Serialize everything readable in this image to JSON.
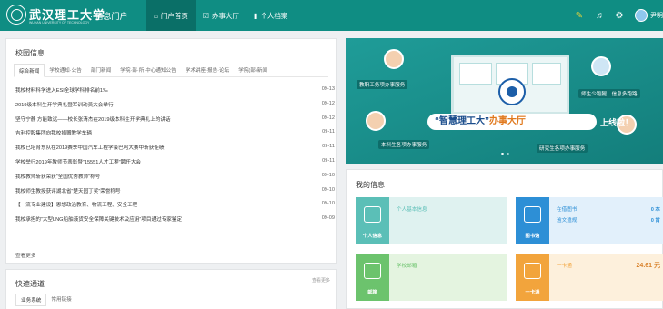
{
  "header": {
    "logo_text": "武汉理工大学",
    "logo_sub": "WUHAN UNIVERSITY OF TECHNOLOGY",
    "portal_title": "· 信息门户",
    "nav": [
      {
        "label": "门户首页",
        "icon": "home-icon",
        "active": true
      },
      {
        "label": "办事大厅",
        "icon": "service-hall-icon",
        "active": false
      },
      {
        "label": "个人档案",
        "icon": "bar-chart-icon",
        "active": false
      }
    ],
    "username": "尹明"
  },
  "news": {
    "title": "校园信息",
    "tabs": [
      "综合新闻",
      "学校通知·公告",
      "部门新闻",
      "学院·部·所·中心通知公告",
      "学术讲座·报告·论坛",
      "学院(部)新闻"
    ],
    "items": [
      {
        "title": "我校材料科学进入ESI全球学科排名前1‰",
        "date": "09-13"
      },
      {
        "title": "2019级本科生开学典礼暨军训动员大会举行",
        "date": "09-12"
      },
      {
        "title": "坚守宁静 方能致远——校长张清杰在2019级本科生开学典礼上的讲话",
        "date": "09-12"
      },
      {
        "title": "吉利控股集团向我校捐赠教学车辆",
        "date": "09-11"
      },
      {
        "title": "我校已培育东队在2019赛季中国汽车工程学会巴哈大赛中斩获佳绩",
        "date": "09-11"
      },
      {
        "title": "学校举行2019年教师节表彰暨“15551人才工程”聘任大会",
        "date": "09-11"
      },
      {
        "title": "我校教师斩获荣获“全国优秀教师”称号",
        "date": "09-10"
      },
      {
        "title": "我校师生教授获评湖北省“楚天园丁奖”荣誉称号",
        "date": "09-10"
      },
      {
        "title": "【一流专业建设】恩想政治教育、物流工程、安全工程",
        "date": "09-10"
      },
      {
        "title": "我校承担的“大型LNG船舶液货安全保障关键技术及应用”项目通过专家鉴定",
        "date": "09-09"
      }
    ],
    "more": "查看更多"
  },
  "quick": {
    "title": "快速通道",
    "more": "查看更多",
    "tabs": [
      "业务系统",
      "常用链接"
    ]
  },
  "banner": {
    "slogan_quote_open": "“智慧理工大”",
    "slogan_hl": "办事大厅",
    "slogan_quote_close": "”",
    "slogan_after": "上线啦！",
    "labels": {
      "teacher": "教职工务项办事服务",
      "student": "师生少跑腿、信息多跑路",
      "undergrad": "本科生各项办事服务",
      "grad": "研究生各项办事服务"
    }
  },
  "my_info": {
    "title": "我的信息",
    "tiles": [
      {
        "name": "个人信息",
        "text1": "个人基本信息",
        "text2": "",
        "value1": "",
        "value2": "",
        "color": "#5bbfb7",
        "bg": "#dff2f0"
      },
      {
        "name": "图书馆",
        "text1": "在借图书",
        "text2": "逾文違规",
        "value1": "0 本",
        "value2": "0 肯",
        "color": "#2d8fd6",
        "bg": "#e2f0fb"
      },
      {
        "name": "邮箱",
        "text1": "学校邮箱",
        "text2": "",
        "value1": "",
        "value2": "",
        "color": "#6cc36d",
        "bg": "#e4f4e0"
      },
      {
        "name": "一卡通",
        "text1": "一卡通",
        "text2": "",
        "value1": "24.61 元",
        "value2": "",
        "color": "#f2a43c",
        "bg": "#fdf0dc"
      }
    ]
  }
}
